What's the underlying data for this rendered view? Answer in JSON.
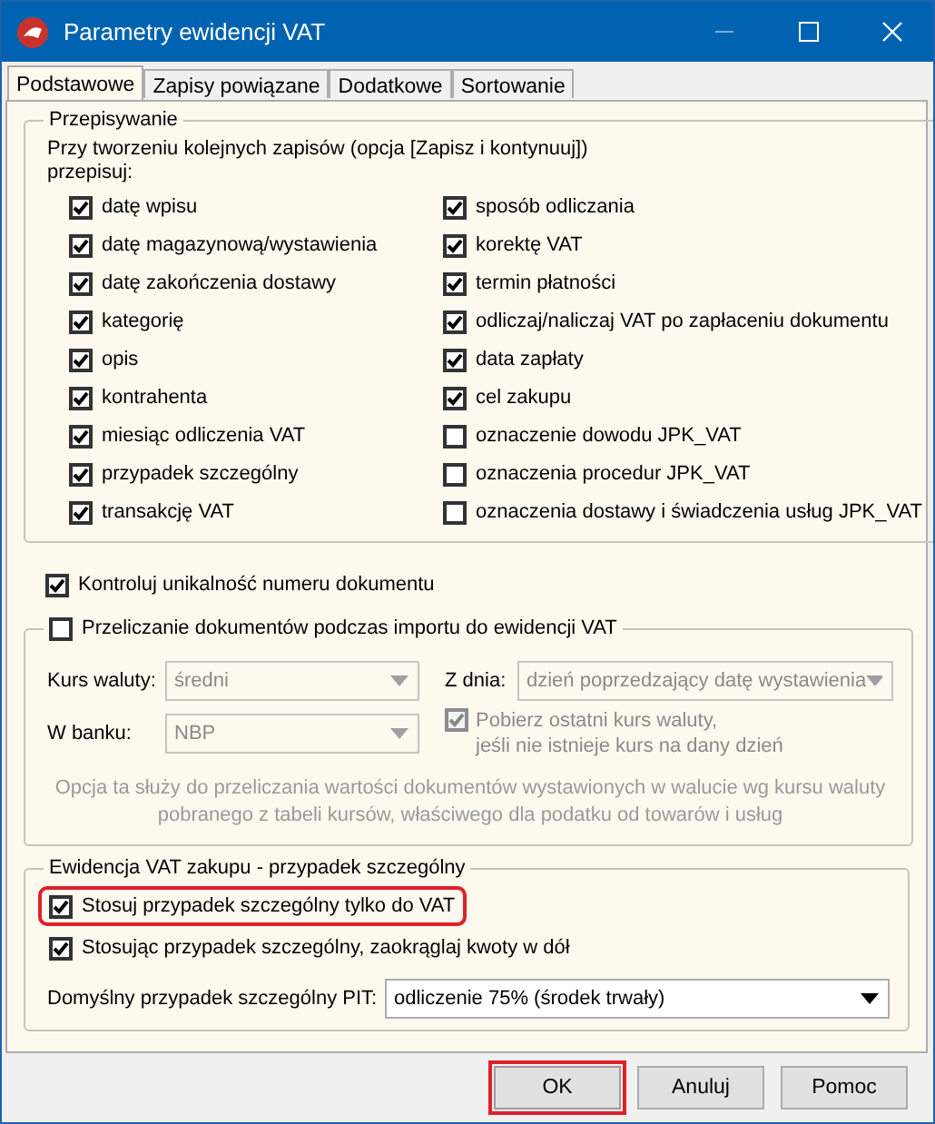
{
  "window": {
    "title": "Parametry ewidencji VAT"
  },
  "tabs": [
    {
      "label": "Podstawowe",
      "selected": true
    },
    {
      "label": "Zapisy powiązane",
      "selected": false
    },
    {
      "label": "Dodatkowe",
      "selected": false
    },
    {
      "label": "Sortowanie",
      "selected": false
    }
  ],
  "copy_group": {
    "title": "Przepisywanie",
    "intro": "Przy tworzeniu kolejnych zapisów (opcja [Zapisz i kontynuuj])\nprzepisuj:",
    "left_column": [
      {
        "label": "datę wpisu",
        "checked": true
      },
      {
        "label": "datę magazynową/wystawienia",
        "checked": true
      },
      {
        "label": "datę zakończenia dostawy",
        "checked": true
      },
      {
        "label": "kategorię",
        "checked": true
      },
      {
        "label": "opis",
        "checked": true
      },
      {
        "label": "kontrahenta",
        "checked": true
      },
      {
        "label": "miesiąc odliczenia VAT",
        "checked": true
      },
      {
        "label": "przypadek szczególny",
        "checked": true
      },
      {
        "label": "transakcję VAT",
        "checked": true
      }
    ],
    "right_column": [
      {
        "label": "sposób odliczania",
        "checked": true
      },
      {
        "label": "korektę VAT",
        "checked": true
      },
      {
        "label": "termin płatności",
        "checked": true
      },
      {
        "label": "odliczaj/naliczaj VAT po zapłaceniu dokumentu",
        "checked": true
      },
      {
        "label": "data zapłaty",
        "checked": true
      },
      {
        "label": "cel zakupu",
        "checked": true
      },
      {
        "label": "oznaczenie dowodu JPK_VAT",
        "checked": false
      },
      {
        "label": "oznaczenia procedur JPK_VAT",
        "checked": false
      },
      {
        "label": "oznaczenia dostawy i świadczenia usług JPK_VAT",
        "checked": false
      }
    ]
  },
  "unique_check": {
    "label": "Kontroluj unikalność numeru dokumentu",
    "checked": true
  },
  "conversion_group": {
    "label": "Przeliczanie dokumentów podczas importu do ewidencji VAT",
    "checked": false,
    "disabled": true,
    "rate": {
      "label": "Kurs waluty:",
      "value": "średni"
    },
    "day": {
      "label": "Z dnia:",
      "value": "dzień poprzedzający datę wystawienia"
    },
    "bank": {
      "label": "W banku:",
      "value": "NBP"
    },
    "last_rate": {
      "label": "Pobierz ostatni kurs waluty,\njeśli nie istnieje kurs na dany dzień",
      "checked": true
    },
    "hint": "Opcja ta służy do przeliczania wartości dokumentów wystawionych w walucie wg kursu waluty\npobranego z tabeli kursów, właściwego dla podatku od towarów i usług"
  },
  "special_group": {
    "title": "Ewidencja VAT zakupu - przypadek szczególny",
    "options": [
      {
        "label": "Stosuj przypadek szczególny tylko do VAT",
        "checked": true,
        "highlighted": true
      },
      {
        "label": "Stosując przypadek szczególny, zaokrąglaj kwoty w dół",
        "checked": true,
        "highlighted": false
      }
    ],
    "pit": {
      "label": "Domyślny przypadek szczególny PIT:",
      "value": "odliczenie 75% (środek trwały)"
    }
  },
  "buttons": [
    {
      "label": "OK",
      "highlighted": true
    },
    {
      "label": "Anuluj",
      "highlighted": false
    },
    {
      "label": "Pomoc",
      "highlighted": false
    }
  ]
}
